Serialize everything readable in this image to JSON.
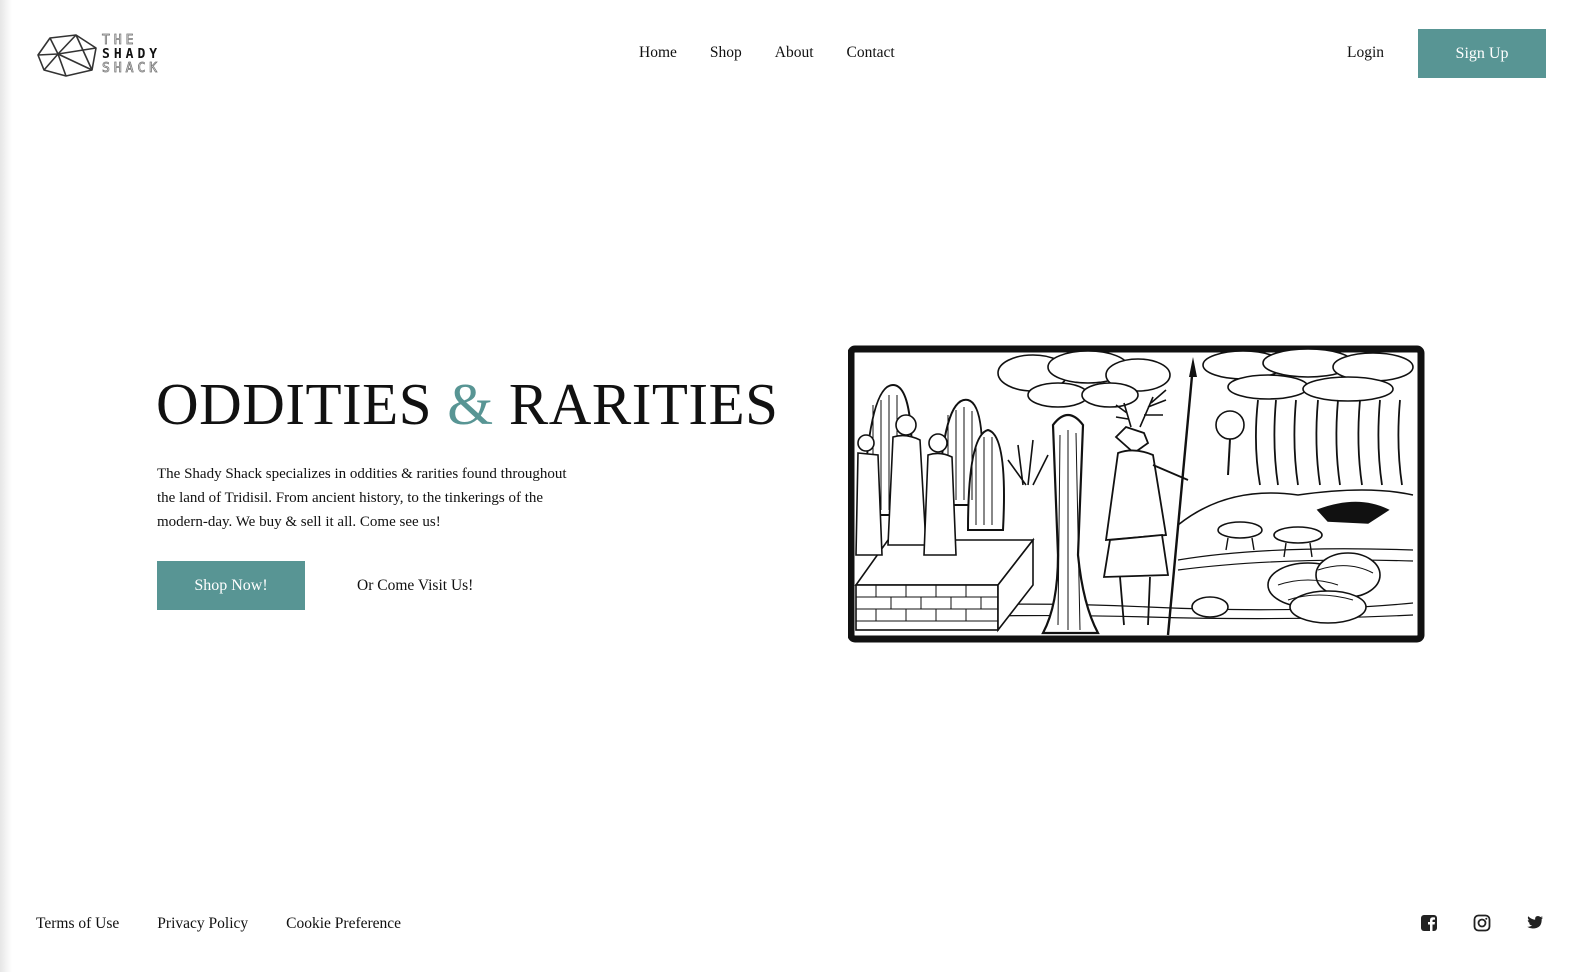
{
  "header": {
    "logo": {
      "line1": "THE",
      "line2": "SHADY",
      "line3": "SHACK"
    },
    "nav": [
      {
        "label": "Home"
      },
      {
        "label": "Shop"
      },
      {
        "label": "About"
      },
      {
        "label": "Contact"
      }
    ],
    "login_label": "Login",
    "signup_label": "Sign Up"
  },
  "hero": {
    "title_part1": "ODDITIES ",
    "title_amp": "&",
    "title_part2": " RARITIES",
    "description": "The Shady Shack specializes in oddities & rarities found throughout the land of Tridisil. From ancient history, to the tinkerings of the modern-day. We buy & sell it all. Come see us!",
    "shop_button_label": "Shop Now!",
    "visit_link_label": "Or Come Visit Us!"
  },
  "footer": {
    "links": [
      {
        "label": "Terms of Use"
      },
      {
        "label": "Privacy Policy"
      },
      {
        "label": "Cookie Preference"
      }
    ],
    "socials": [
      {
        "icon": "facebook-icon"
      },
      {
        "icon": "instagram-icon"
      },
      {
        "icon": "twitter-icon"
      }
    ]
  },
  "colors": {
    "accent": "#589594",
    "text": "#111111",
    "background": "#ffffff"
  }
}
